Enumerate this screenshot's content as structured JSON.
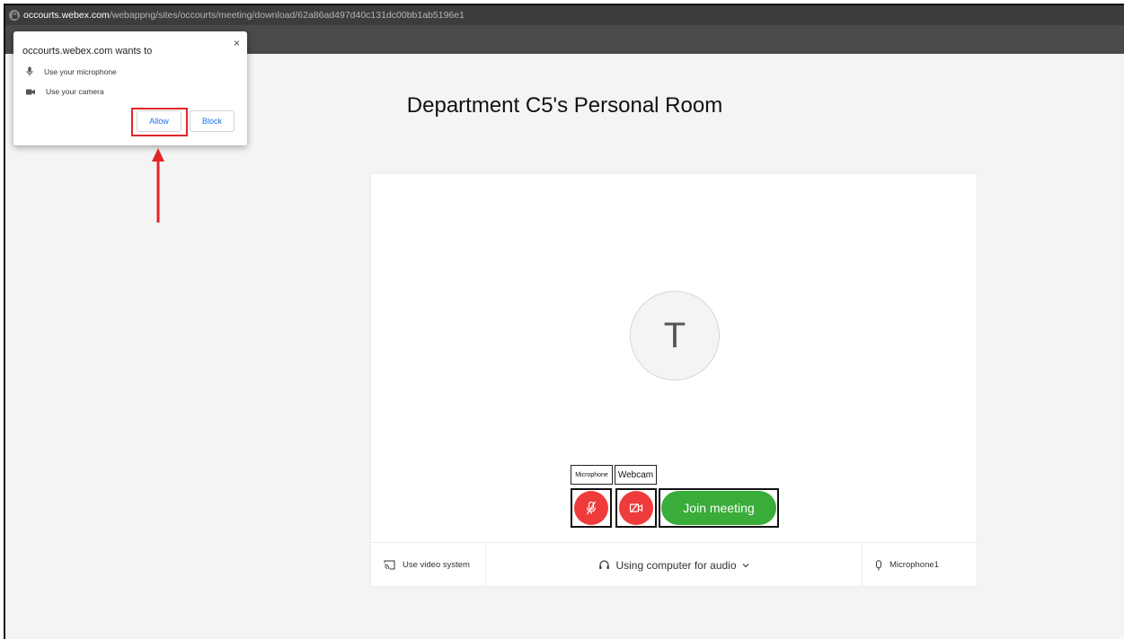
{
  "address_bar": {
    "domain": "occourts.webex.com",
    "path": "/webappng/sites/occourts/meeting/download/62a86ad497d40c131dc00bb1ab5196e1"
  },
  "meeting": {
    "title": "Department C5's Personal Room",
    "avatar_initial": "T",
    "mic_tag": "Microphone",
    "cam_tag": "Webcam",
    "join_label": "Join meeting",
    "video_system_label": "Use video system",
    "audio_label": "Using computer for audio",
    "microphone_label": "Microphone1"
  },
  "permission_prompt": {
    "title": "occourts.webex.com wants to",
    "close": "×",
    "items": [
      {
        "label": "Use your microphone",
        "icon": "microphone-icon"
      },
      {
        "label": "Use your camera",
        "icon": "camera-icon"
      }
    ],
    "allow_label": "Allow",
    "block_label": "Block"
  },
  "colors": {
    "join_green": "#3aac3a",
    "muted_red": "#ef3b3b",
    "highlight_red": "#e0262b",
    "link_blue": "#1a73e8"
  }
}
